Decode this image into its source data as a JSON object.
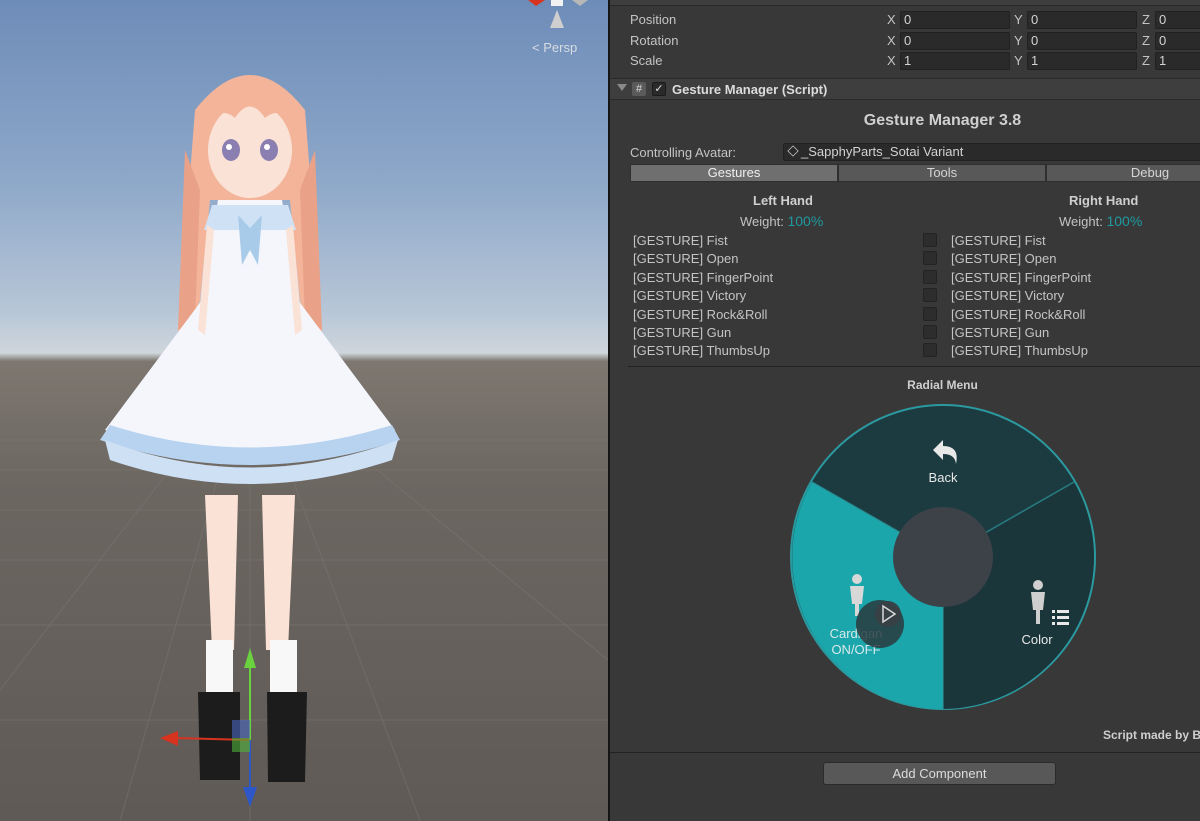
{
  "scene": {
    "view_mode_label": "Persp"
  },
  "transform": {
    "rows": [
      {
        "label": "Position",
        "x": "0",
        "y": "0",
        "z": "0"
      },
      {
        "label": "Rotation",
        "x": "0",
        "y": "0",
        "z": "0"
      },
      {
        "label": "Scale",
        "x": "1",
        "y": "1",
        "z": "1"
      }
    ],
    "axis_labels": {
      "x": "X",
      "y": "Y",
      "z": "Z"
    }
  },
  "component": {
    "title": "Gesture Manager (Script)",
    "script_icon": "#",
    "enabled_mark": "✓"
  },
  "gesture_manager": {
    "title": "Gesture Manager 3.8",
    "controlling_avatar_label": "Controlling Avatar:",
    "controlling_avatar_value": "_SapphyParts_Sotai Variant",
    "tabs": [
      {
        "label": "Gestures",
        "active": true
      },
      {
        "label": "Tools",
        "active": false
      },
      {
        "label": "Debug",
        "active": false
      }
    ],
    "left_hand": {
      "title": "Left Hand",
      "weight_label": "Weight:",
      "weight_value": "100%",
      "gestures": [
        "[GESTURE] Fist",
        "[GESTURE] Open",
        "[GESTURE] FingerPoint",
        "[GESTURE] Victory",
        "[GESTURE] Rock&Roll",
        "[GESTURE] Gun",
        "[GESTURE] ThumbsUp"
      ]
    },
    "right_hand": {
      "title": "Right Hand",
      "weight_label": "Weight:",
      "weight_value": "100%",
      "gestures": [
        "[GESTURE] Fist",
        "[GESTURE] Open",
        "[GESTURE] FingerPoint",
        "[GESTURE] Victory",
        "[GESTURE] Rock&Roll",
        "[GESTURE] Gun",
        "[GESTURE] ThumbsUp"
      ]
    },
    "radial_menu": {
      "title": "Radial Menu",
      "items": [
        {
          "label": "Back",
          "icon": "back-arrow-icon",
          "selected": false
        },
        {
          "label": "Color",
          "icon": "avatar-list-icon",
          "selected": false
        },
        {
          "label": "Cardigan ON/OFF",
          "line1": "Cardigan",
          "line2": "ON/OFF",
          "icon": "avatar-play-icon",
          "selected": true
        }
      ],
      "colors": {
        "ring": "#2b9aa0",
        "segment": "#1d3a3f",
        "selected": "#1aa6ab",
        "center": "#3c4247"
      }
    },
    "credit": "Script made by BlackStartx"
  },
  "add_component_label": "Add Component"
}
